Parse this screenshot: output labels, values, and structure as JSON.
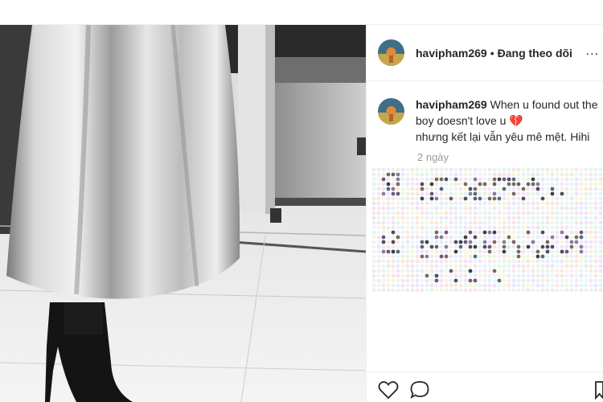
{
  "post": {
    "username": "havipham269",
    "separator": "•",
    "follow_status": "Đang theo dõi",
    "more_menu": "...",
    "caption": {
      "username": "havipham269",
      "line1": "When u found out the boy doesn't love u 💔",
      "line2": "nhưng kết lại vẫn yêu mê mệt. Hihi"
    },
    "timestamp": "2 ngày"
  },
  "actions": {
    "like_icon": "heart-outline-icon",
    "comment_icon": "speech-bubble-icon",
    "save_icon": "bookmark-icon"
  },
  "colors": {
    "text": "#262626",
    "muted": "#999999",
    "border": "#efefef"
  }
}
